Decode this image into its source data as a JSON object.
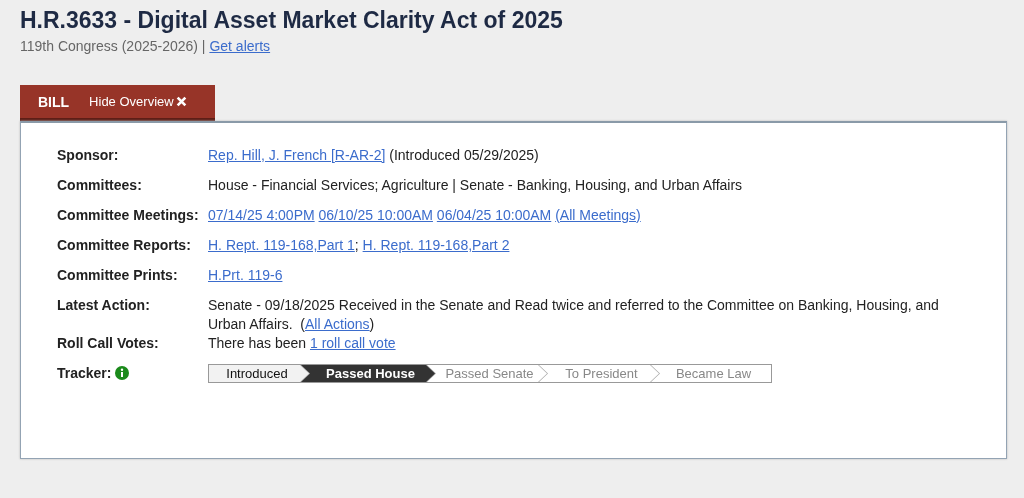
{
  "title": "H.R.3633 - Digital Asset Market Clarity Act of 2025",
  "subtitle": {
    "text": "119th Congress (2025-2026) |",
    "link": "Get alerts"
  },
  "tabs": [
    {
      "label": "BILL",
      "selected": true
    },
    {
      "label": "Hide Overview",
      "kind": "close"
    }
  ],
  "rows": [
    {
      "label": "Sponsor:",
      "value": [
        {
          "kind": "link",
          "text": "Rep. Hill, J. French [R-AR-2]"
        },
        {
          "kind": "text",
          "text": "(Introduced 05/29/2025)"
        }
      ]
    },
    {
      "label": "Committees:",
      "value": [
        {
          "kind": "text",
          "text": "House - Financial Services; Agriculture | Senate - Banking, Housing, and Urban Affairs"
        }
      ]
    },
    {
      "label": "Committee Meetings:",
      "value": [
        {
          "kind": "link",
          "text": "07/14/25 4:00PM"
        },
        {
          "kind": "link",
          "text": "06/10/25 10:00AM"
        },
        {
          "kind": "link",
          "text": "06/04/25 10:00AM"
        },
        {
          "kind": "link",
          "text": "(All Meetings)"
        }
      ]
    },
    {
      "label": "Committee Reports:",
      "value": [
        {
          "kind": "link",
          "text": "H. Rept. 119-168,Part 1"
        },
        {
          "kind": "text",
          "text": ";"
        },
        {
          "kind": "link",
          "text": "H. Rept. 119-168,Part 2"
        }
      ]
    },
    {
      "label": "Committee Prints:",
      "value": [
        {
          "kind": "link",
          "text": "H.Prt. 119-6"
        }
      ]
    },
    {
      "label": "Latest Action:",
      "value": [
        {
          "kind": "text",
          "text": "Senate - 09/18/2025 Received in the Senate and Read twice and referred to the Committee on Banking, Housing, and Urban Affairs.  ("
        },
        {
          "kind": "link",
          "text": "All Actions"
        },
        {
          "kind": "text",
          "text": ")"
        }
      ]
    },
    {
      "label": "Roll Call Votes:",
      "value": [
        {
          "kind": "text",
          "text": "There has been"
        },
        {
          "kind": "link",
          "text": "1 roll call vote"
        }
      ]
    }
  ],
  "tracker": {
    "label": "Tracker:",
    "steps": [
      {
        "label": "Introduced",
        "completed": true,
        "selected": false
      },
      {
        "label": "Passed House",
        "completed": true,
        "selected": true
      },
      {
        "label": "Passed Senate",
        "completed": false,
        "selected": false
      },
      {
        "label": "To President",
        "completed": false,
        "selected": false
      },
      {
        "label": "Became Law",
        "completed": false,
        "selected": false
      }
    ]
  }
}
